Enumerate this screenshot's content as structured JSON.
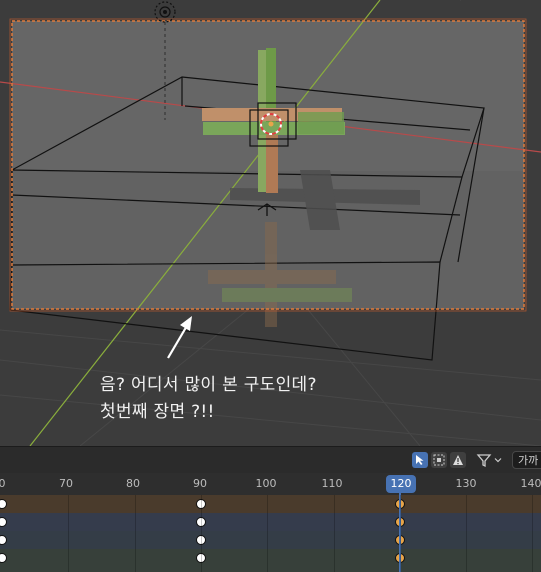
{
  "annotation": {
    "line1": "음? 어디서 많이 본 구도인데?",
    "line2": "첫번째 장면 ?!!"
  },
  "header": {
    "search_text": "가까",
    "icons": [
      "select-cursor-icon",
      "box-select-icon",
      "warning-icon",
      "filter-funnel-icon",
      "chevron-down-icon"
    ]
  },
  "timeline": {
    "frame_labels": [
      "0",
      "70",
      "80",
      "90",
      "100",
      "110",
      "130",
      "140"
    ],
    "current_frame": "120",
    "track_colors": [
      "#4a3b2c",
      "#353c4c",
      "#343d47",
      "#37403a"
    ],
    "keyframe_frames": [
      60,
      90,
      120
    ],
    "selected_frame": 120
  },
  "colors": {
    "accent": "#4772b3",
    "camera_frame": "#e07a3a",
    "x_axis": "#b04040",
    "y_axis": "#7ea534"
  }
}
